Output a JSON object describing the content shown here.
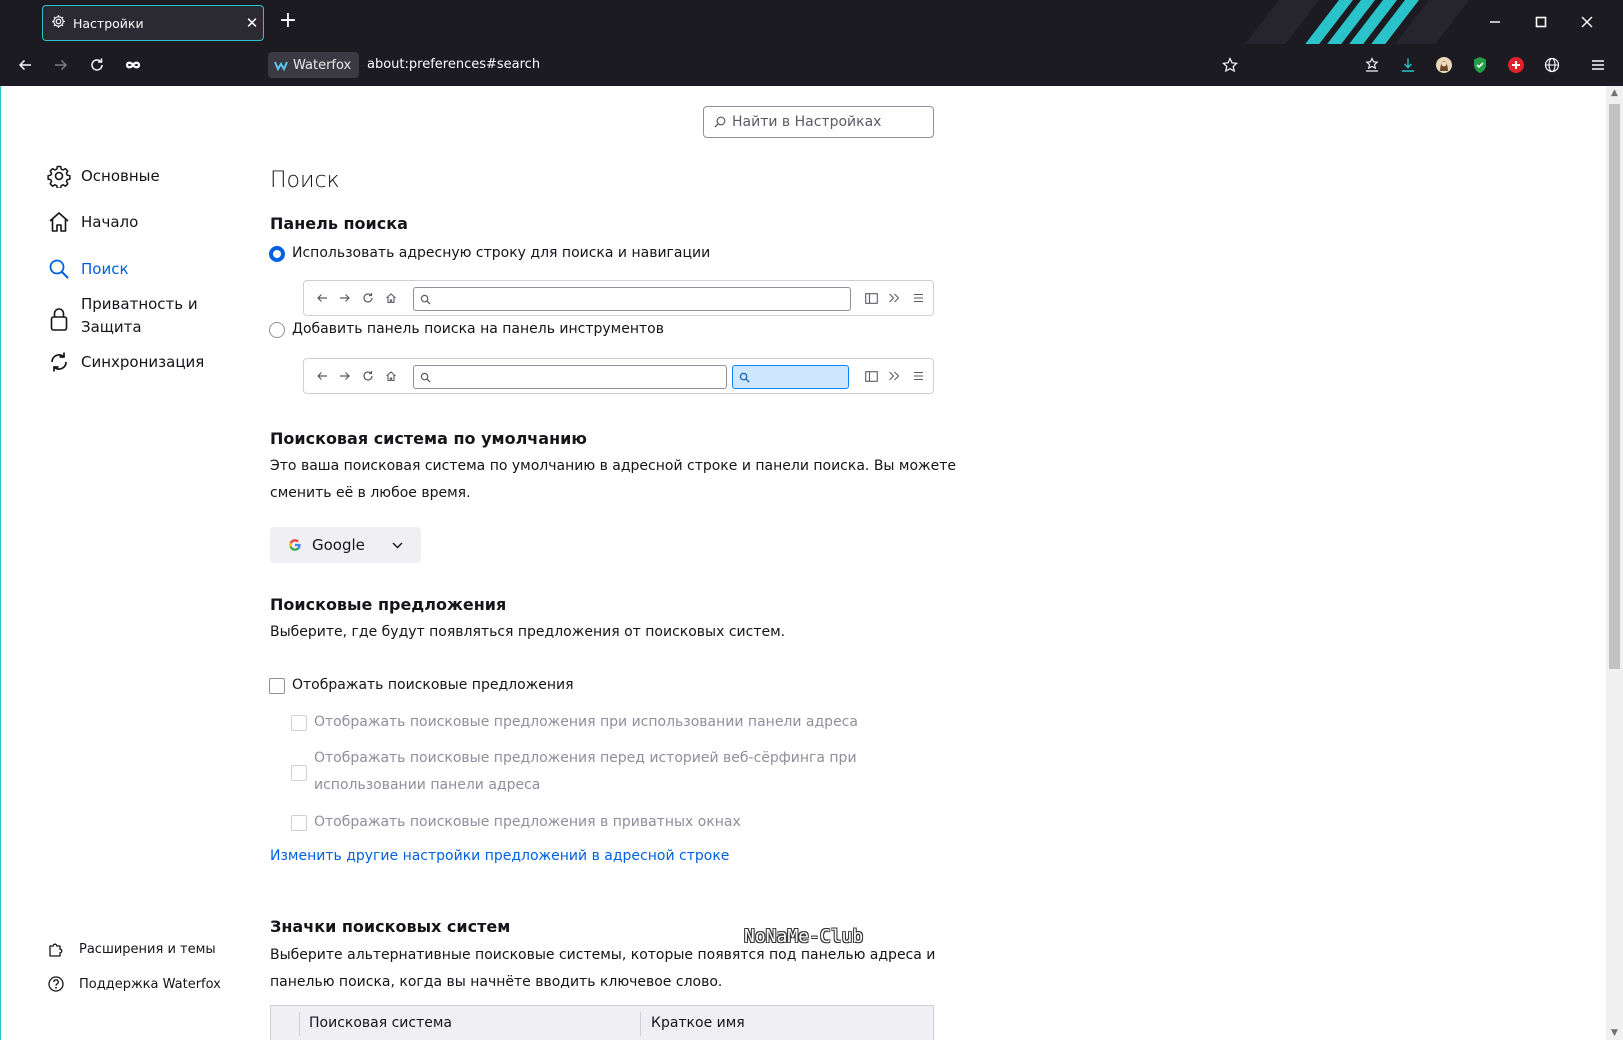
{
  "tab": {
    "title": "Настройки",
    "close": "✕",
    "new_tab": "+"
  },
  "window_controls": {
    "minimize": "minimize",
    "maximize": "maximize",
    "close": "close"
  },
  "navbar": {
    "identity_label": "Waterfox",
    "url": "about:preferences#search"
  },
  "search_prefs": {
    "placeholder": "Найти в Настройках"
  },
  "sidebar": {
    "items": [
      {
        "label": "Основные",
        "icon": "gear-icon"
      },
      {
        "label": "Начало",
        "icon": "home-icon"
      },
      {
        "label": "Поиск",
        "icon": "search-icon",
        "active": true
      },
      {
        "label": "Приватность и Защита",
        "icon": "lock-icon"
      },
      {
        "label": "Синхронизация",
        "icon": "sync-icon"
      }
    ],
    "footer": [
      {
        "label": "Расширения и темы",
        "icon": "puzzle-icon"
      },
      {
        "label": "Поддержка Waterfox",
        "icon": "help-icon"
      }
    ]
  },
  "main": {
    "title": "Поиск",
    "search_bar": {
      "heading": "Панель поиска",
      "option_address": "Использовать адресную строку для поиска и навигации",
      "option_toolbar": "Добавить панель поиска на панель инструментов",
      "selected": "option_address"
    },
    "default_engine": {
      "heading": "Поисковая система по умолчанию",
      "description_line1": "Это ваша поисковая система по умолчанию в адресной строке и панели поиска. Вы можете",
      "description_line2": "сменить её в любое время.",
      "selected": "Google"
    },
    "suggestions": {
      "heading": "Поисковые предложения",
      "description": "Выберите, где будут появляться предложения от поисковых систем.",
      "show": "Отображать поисковые предложения",
      "in_address_bar": "Отображать поисковые предложения при использовании панели адреса",
      "before_history_line1": "Отображать поисковые предложения перед историей веб-сёрфинга при",
      "before_history_line2": "использовании панели адреса",
      "in_private": "Отображать поисковые предложения в приватных окнах",
      "link": "Изменить другие настройки предложений в адресной строке"
    },
    "shortcuts": {
      "heading": "Значки поисковых систем",
      "description_line1": "Выберите альтернативные поисковые системы, которые появятся под панелью адреса и",
      "description_line2": "панелью поиска, когда вы начнёте вводить ключевое слово.",
      "columns": [
        "Поисковая система",
        "Краткое имя"
      ]
    }
  },
  "watermark": "NoNaMe-Club",
  "colors": {
    "accent": "#0061e0",
    "chrome": "#1c1b22",
    "tab_border": "#2ac3c9"
  }
}
